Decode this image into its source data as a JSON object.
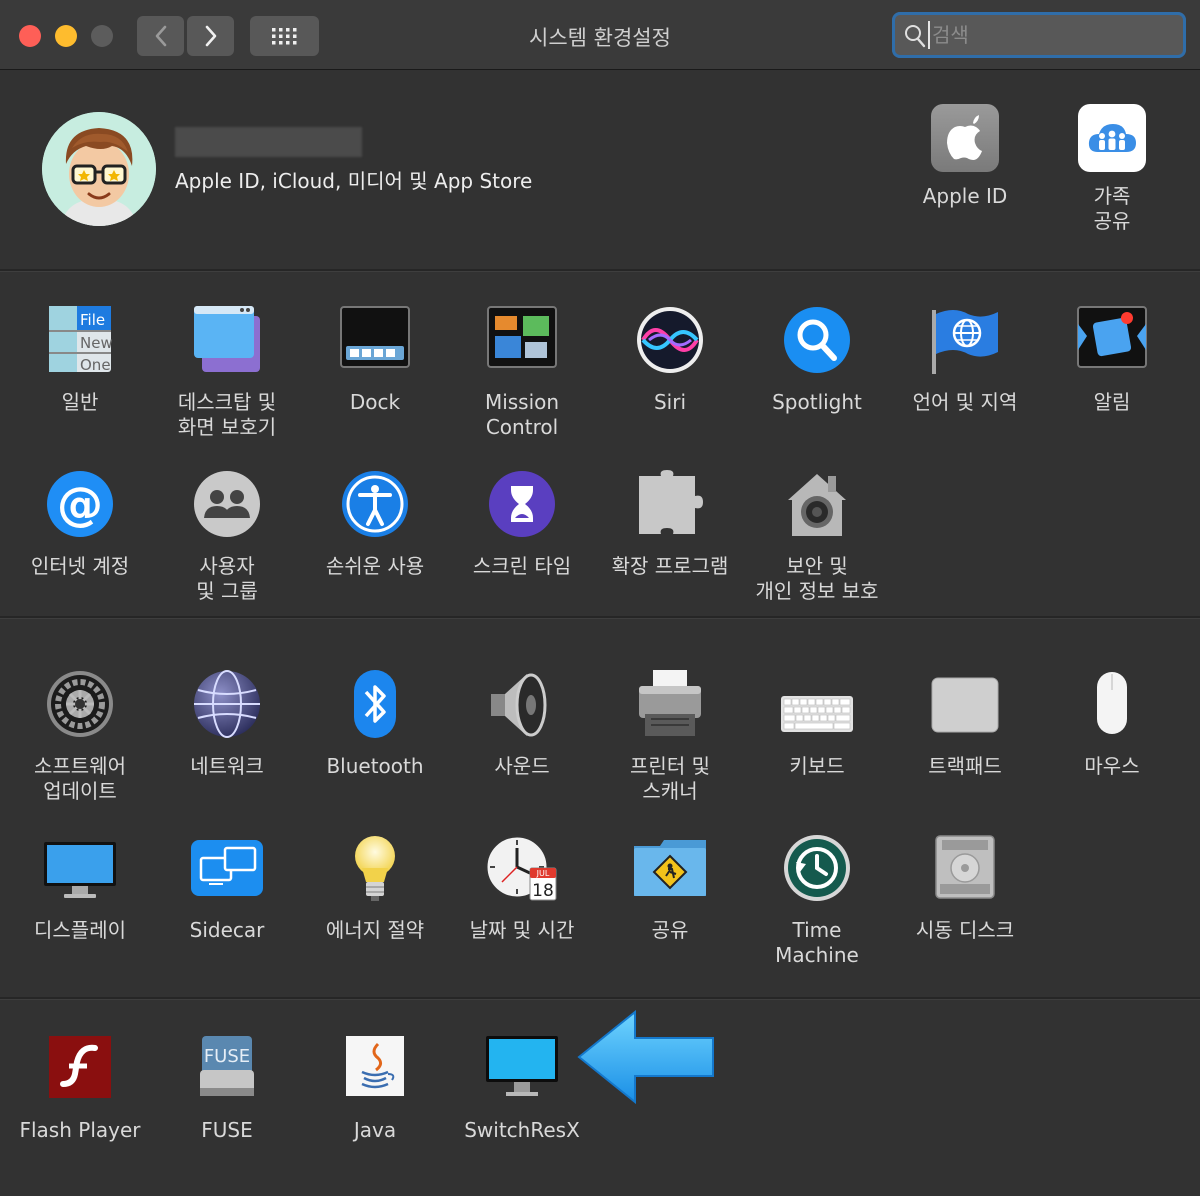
{
  "window": {
    "title": "시스템 환경설정",
    "search_placeholder": "검색"
  },
  "account": {
    "subtitle": "Apple ID, iCloud, 미디어 및 App Store",
    "items": [
      {
        "label": "Apple ID",
        "icon": "apple-id-icon"
      },
      {
        "label": "가족\n공유",
        "icon": "family-sharing-icon"
      }
    ]
  },
  "section1": [
    {
      "label": "일반",
      "icon": "general-icon"
    },
    {
      "label": "데스크탑 및\n화면 보호기",
      "icon": "desktop-screensaver-icon"
    },
    {
      "label": "Dock",
      "icon": "dock-icon"
    },
    {
      "label": "Mission\nControl",
      "icon": "mission-control-icon"
    },
    {
      "label": "Siri",
      "icon": "siri-icon"
    },
    {
      "label": "Spotlight",
      "icon": "spotlight-icon"
    },
    {
      "label": "언어 및 지역",
      "icon": "language-region-icon"
    },
    {
      "label": "알림",
      "icon": "notifications-icon"
    },
    {
      "label": "인터넷 계정",
      "icon": "internet-accounts-icon"
    },
    {
      "label": "사용자\n및 그룹",
      "icon": "users-groups-icon"
    },
    {
      "label": "손쉬운 사용",
      "icon": "accessibility-icon"
    },
    {
      "label": "스크린 타임",
      "icon": "screen-time-icon"
    },
    {
      "label": "확장 프로그램",
      "icon": "extensions-icon"
    },
    {
      "label": "보안 및\n개인 정보 보호",
      "icon": "security-privacy-icon"
    }
  ],
  "section2": [
    {
      "label": "소프트웨어\n업데이트",
      "icon": "software-update-icon"
    },
    {
      "label": "네트워크",
      "icon": "network-icon"
    },
    {
      "label": "Bluetooth",
      "icon": "bluetooth-icon"
    },
    {
      "label": "사운드",
      "icon": "sound-icon"
    },
    {
      "label": "프린터 및\n스캐너",
      "icon": "printers-scanners-icon"
    },
    {
      "label": "키보드",
      "icon": "keyboard-icon"
    },
    {
      "label": "트랙패드",
      "icon": "trackpad-icon"
    },
    {
      "label": "마우스",
      "icon": "mouse-icon"
    },
    {
      "label": "디스플레이",
      "icon": "displays-icon"
    },
    {
      "label": "Sidecar",
      "icon": "sidecar-icon"
    },
    {
      "label": "에너지 절약",
      "icon": "energy-saver-icon"
    },
    {
      "label": "날짜 및 시간",
      "icon": "date-time-icon",
      "cal_month": "JUL",
      "cal_day": "18"
    },
    {
      "label": "공유",
      "icon": "sharing-icon"
    },
    {
      "label": "Time\nMachine",
      "icon": "time-machine-icon"
    },
    {
      "label": "시동 디스크",
      "icon": "startup-disk-icon"
    }
  ],
  "section3": [
    {
      "label": "Flash Player",
      "icon": "flash-player-icon"
    },
    {
      "label": "FUSE",
      "icon": "fuse-icon",
      "icon_text": "FUSE"
    },
    {
      "label": "Java",
      "icon": "java-icon"
    },
    {
      "label": "SwitchResX",
      "icon": "switchresx-icon"
    }
  ],
  "general_icon_text": [
    "File",
    "New",
    "One"
  ]
}
